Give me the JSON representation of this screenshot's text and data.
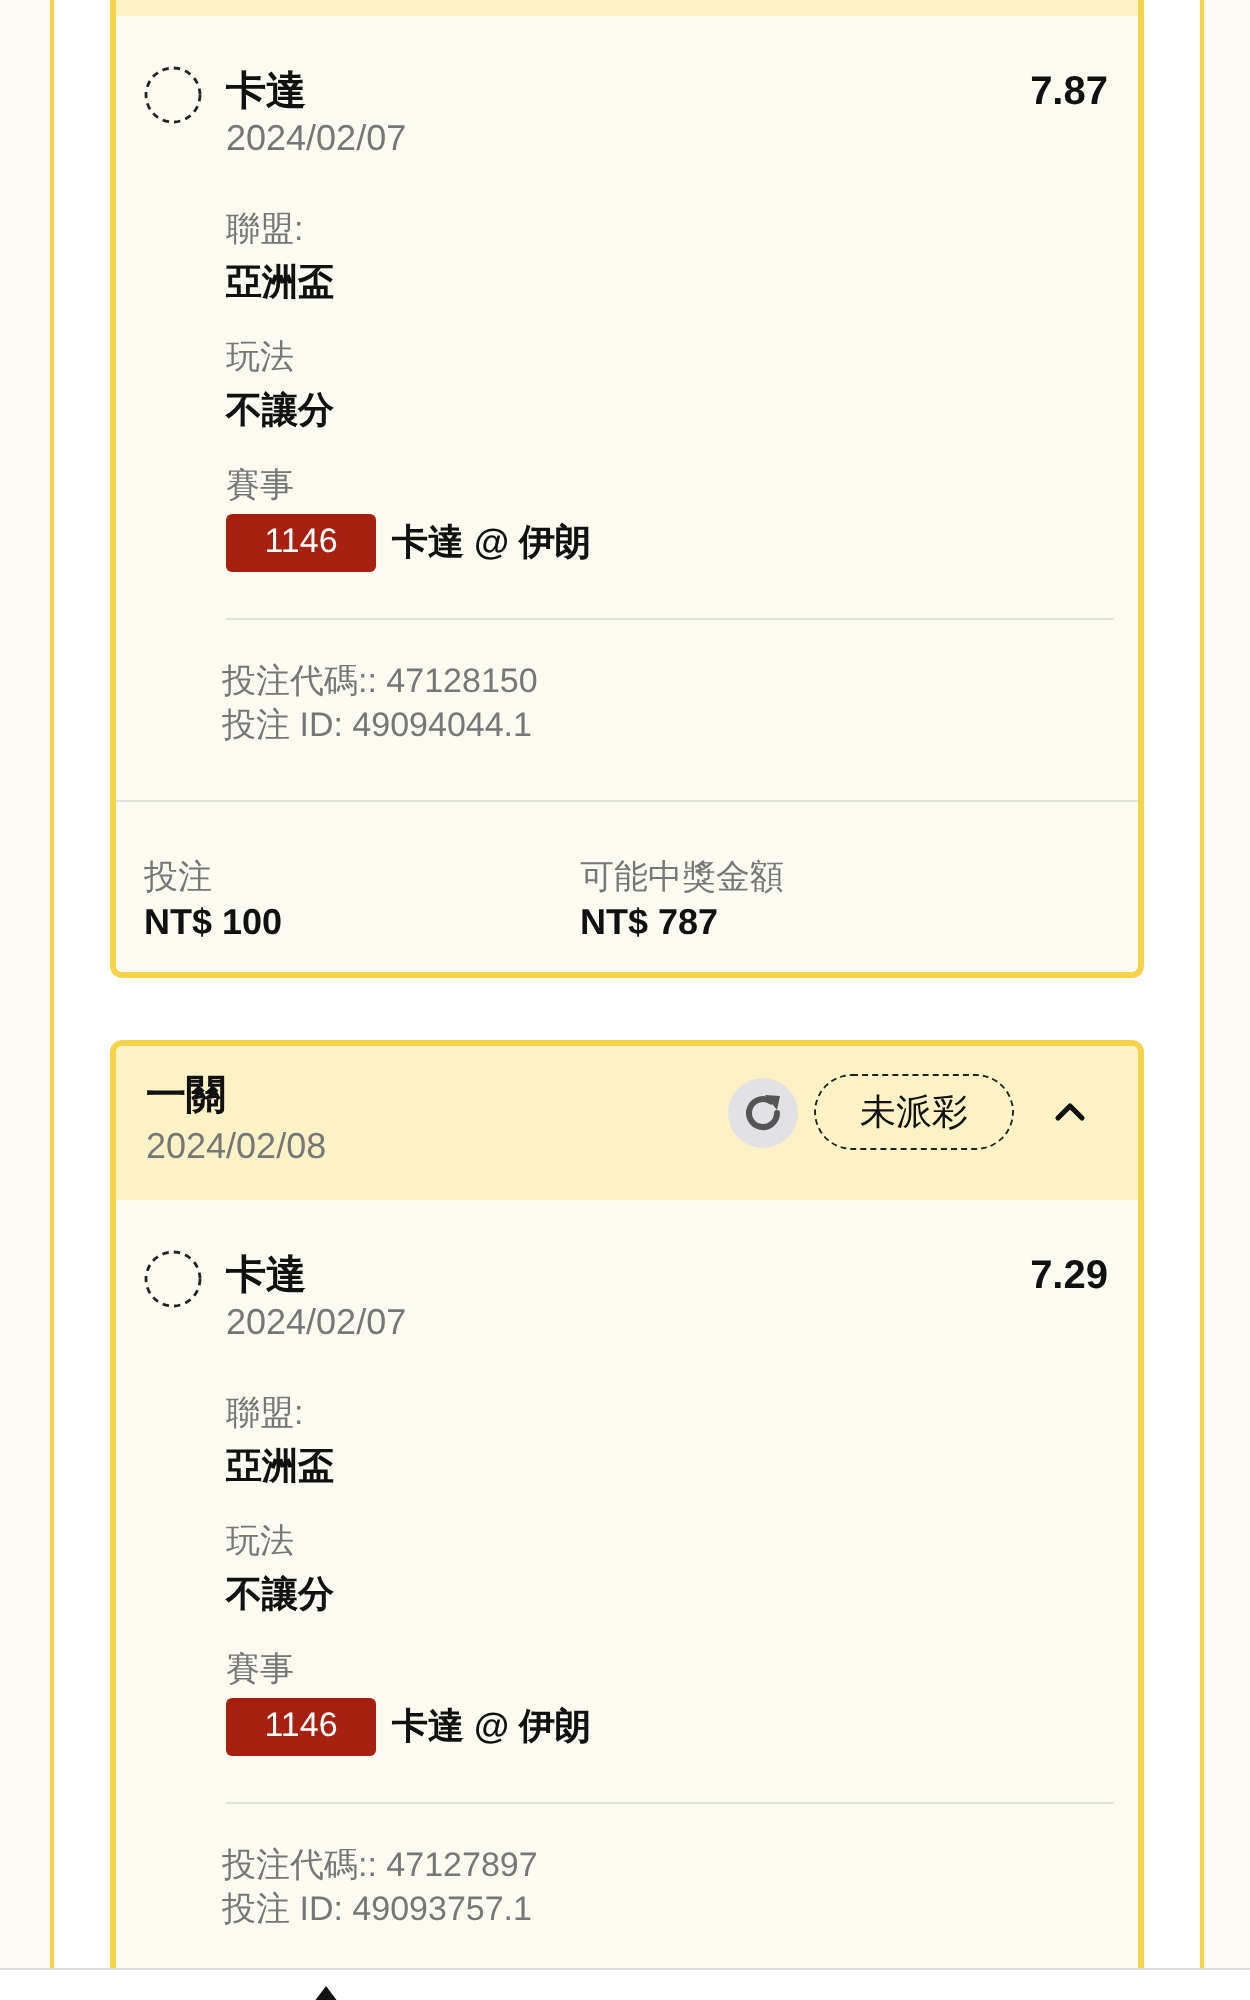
{
  "bets": [
    {
      "selections": [
        {
          "team": "卡達",
          "date": "2024/02/07",
          "odds": "7.87",
          "fields": [
            {
              "label": "聯盟:",
              "value": "亞洲盃"
            },
            {
              "label": "玩法",
              "value": "不讓分"
            }
          ],
          "event": {
            "label": "賽事",
            "code": "1146",
            "match": "卡達 @ 伊朗"
          },
          "references": [
            "投注代碼:: 47128150",
            "投注 ID: 49094044.1"
          ]
        }
      ],
      "summary": [
        {
          "label": "投注",
          "value": "NT$ 100"
        },
        {
          "label": "可能中獎金額",
          "value": "NT$ 787"
        }
      ]
    },
    {
      "title": "一關",
      "date": "2024/02/08",
      "status": "未派彩",
      "expanded": true,
      "selections": [
        {
          "team": "卡達",
          "date": "2024/02/07",
          "odds": "7.29",
          "fields": [
            {
              "label": "聯盟:",
              "value": "亞洲盃"
            },
            {
              "label": "玩法",
              "value": "不讓分"
            }
          ],
          "event": {
            "label": "賽事",
            "code": "1146",
            "match": "卡達 @ 伊朗"
          },
          "references": [
            "投注代碼:: 47127897",
            "投注 ID: 49093757.1"
          ]
        }
      ]
    }
  ]
}
